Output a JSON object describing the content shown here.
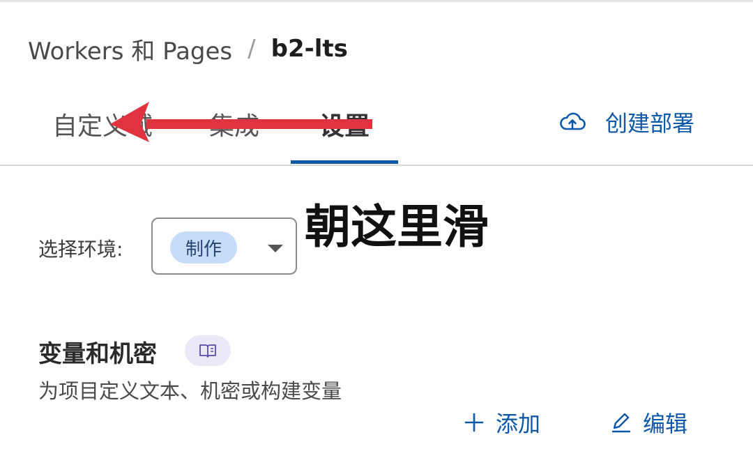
{
  "breadcrumb": {
    "parent": "Workers 和 Pages",
    "separator": "/",
    "current": "b2-lts"
  },
  "tabs": [
    {
      "label": "自定义域",
      "active": false
    },
    {
      "label": "集成",
      "active": false
    },
    {
      "label": "设置",
      "active": true
    }
  ],
  "deploy_button": {
    "label": "创建部署",
    "icon": "cloud-upload-icon"
  },
  "overlay": {
    "hint": "朝这里滑",
    "arrow_color": "#e0323f"
  },
  "environment": {
    "label": "选择环境:",
    "selected": "制作"
  },
  "variables_section": {
    "title": "变量和机密",
    "doc_icon": "book-icon",
    "description": "为项目定义文本、机密或构建变量",
    "add_label": "添加",
    "edit_label": "编辑"
  },
  "colors": {
    "accent": "#0b57a8",
    "chip_bg": "#c7dcf6",
    "doc_chip_bg": "#ece8f7"
  }
}
